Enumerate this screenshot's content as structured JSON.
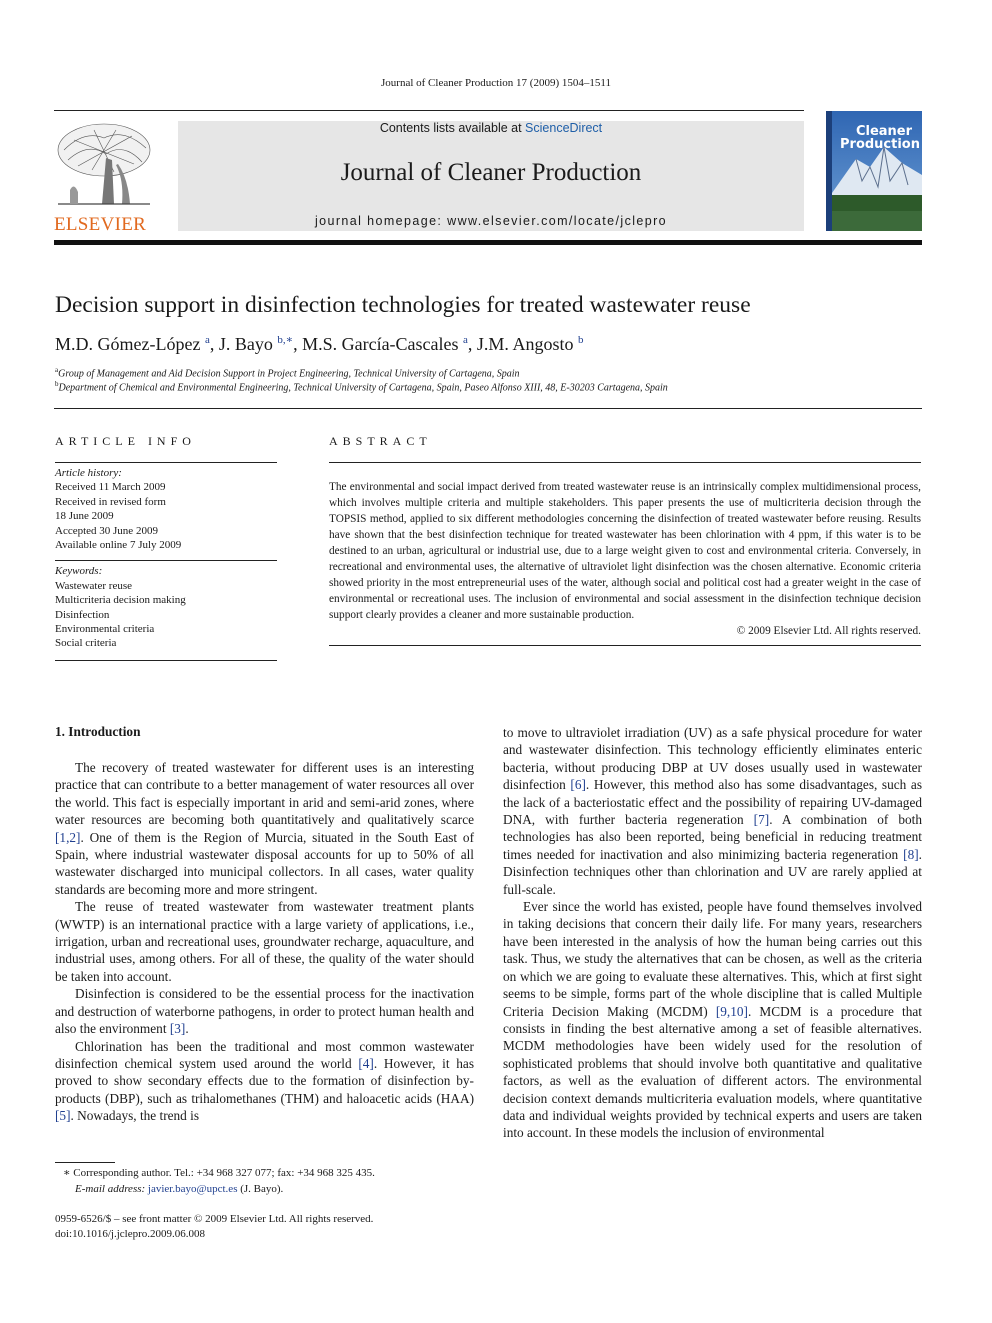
{
  "running_head": "Journal of Cleaner Production 17 (2009) 1504–1511",
  "masthead": {
    "publisher_logo": "ELSEVIER",
    "contents_prefix": "Contents lists available at ",
    "contents_link": "ScienceDirect",
    "journal_title": "Journal of Cleaner Production",
    "homepage": "journal homepage: www.elsevier.com/locate/jclepro",
    "cover_title_line1": "Cleaner",
    "cover_title_line2": "Production"
  },
  "colors": {
    "elsevier_orange": "#e1691f",
    "link_blue": "#1f5fa8",
    "ref_blue": "#1f3f8f",
    "banner_gray": "#e6e6e6"
  },
  "article": {
    "title": "Decision support in disinfection technologies for treated wastewater reuse",
    "authors": [
      {
        "name": "M.D. Gómez-López",
        "sup": "a",
        "sep": ", "
      },
      {
        "name": "J. Bayo",
        "sup": "b,∗",
        "sep": ", "
      },
      {
        "name": "M.S. García-Cascales",
        "sup": "a",
        "sep": ", "
      },
      {
        "name": "J.M. Angosto",
        "sup": "b",
        "sep": ""
      }
    ],
    "affiliations": [
      {
        "mark": "a",
        "text": "Group of Management and Aid Decision Support in Project Engineering, Technical University of Cartagena, Spain"
      },
      {
        "mark": "b",
        "text": "Department of Chemical and Environmental Engineering, Technical University of Cartagena, Spain, Paseo Alfonso XIII, 48, E-30203 Cartagena, Spain"
      }
    ]
  },
  "article_info": {
    "heading": "ARTICLE INFO",
    "history_label": "Article history:",
    "history": [
      "Received 11 March 2009",
      "Received in revised form",
      "18 June 2009",
      "Accepted 30 June 2009",
      "Available online 7 July 2009"
    ],
    "keywords_label": "Keywords:",
    "keywords": [
      "Wastewater reuse",
      "Multicriteria decision making",
      "Disinfection",
      "Environmental criteria",
      "Social criteria"
    ]
  },
  "abstract": {
    "heading": "ABSTRACT",
    "text": "The environmental and social impact derived from treated wastewater reuse is an intrinsically complex multidimensional process, which involves multiple criteria and multiple stakeholders. This paper presents the use of multicriteria decision through the TOPSIS method, applied to six different methodologies concerning the disinfection of treated wastewater before reusing. Results have shown that the best disinfection technique for treated wastewater has been chlorination with 4 ppm, if this water is to be destined to an urban, agricultural or industrial use, due to a large weight given to cost and environmental criteria. Conversely, in recreational and environmental uses, the alternative of ultraviolet light disinfection was the chosen alternative. Economic criteria showed priority in the most entrepreneurial uses of the water, although social and political cost had a greater weight in the case of environmental or recreational uses. The inclusion of environmental and social assessment in the disinfection technique decision support clearly provides a cleaner and more sustainable production.",
    "copyright": "© 2009 Elsevier Ltd. All rights reserved."
  },
  "body": {
    "section_heading": "1.  Introduction",
    "left_paragraphs": [
      [
        {
          "t": "The recovery of treated wastewater for different uses is an interesting practice that can contribute to a better management of water resources all over the world. This fact is especially important in arid and semi-arid zones, where water resources are becoming both quantitatively and qualitatively scarce "
        },
        {
          "r": "[1,2]"
        },
        {
          "t": ". One of them is the Region of Murcia, situated in the South East of Spain, where industrial wastewater disposal accounts for up to 50% of all wastewater discharged into municipal collectors. In all cases, water quality standards are becoming more and more stringent."
        }
      ],
      [
        {
          "t": "The reuse of treated wastewater from wastewater treatment plants (WWTP) is an international practice with a large variety of applications, i.e., irrigation, urban and recreational uses, groundwater recharge, aquaculture, and industrial uses, among others. For all of these, the quality of the water should be taken into account."
        }
      ],
      [
        {
          "t": "Disinfection is considered to be the essential process for the inactivation and destruction of waterborne pathogens, in order to protect human health and also the environment "
        },
        {
          "r": "[3]"
        },
        {
          "t": "."
        }
      ],
      [
        {
          "t": "Chlorination has been the traditional and most common wastewater disinfection chemical system used around the world "
        },
        {
          "r": "[4]"
        },
        {
          "t": ". However, it has proved to show secondary effects due to the formation of disinfection by-products (DBP), such as trihalomethanes (THM) and haloacetic acids (HAA) "
        },
        {
          "r": "[5]"
        },
        {
          "t": ". Nowadays, the trend is"
        }
      ]
    ],
    "right_paragraphs": [
      [
        {
          "t": "to move to ultraviolet irradiation (UV) as a safe physical procedure for water and wastewater disinfection. This technology efficiently eliminates enteric bacteria, without producing DBP at UV doses usually used in wastewater disinfection "
        },
        {
          "r": "[6]"
        },
        {
          "t": ". However, this method also has some disadvantages, such as the lack of a bacteriostatic effect and the possibility of repairing UV-damaged DNA, with further bacteria regeneration "
        },
        {
          "r": "[7]"
        },
        {
          "t": ". A combination of both technologies has also been reported, being beneficial in reducing treatment times needed for inactivation and also minimizing bacteria regeneration "
        },
        {
          "r": "[8]"
        },
        {
          "t": ". Disinfection techniques other than chlorination and UV are rarely applied at full-scale."
        }
      ],
      [
        {
          "t": "Ever since the world has existed, people have found themselves involved in taking decisions that concern their daily life. For many years, researchers have been interested in the analysis of how the human being carries out this task. Thus, we study the alternatives that can be chosen, as well as the criteria on which we are going to evaluate these alternatives. This, which at first sight seems to be simple, forms part of the whole discipline that is called Multiple Criteria Decision Making (MCDM) "
        },
        {
          "r": "[9,10]"
        },
        {
          "t": ". MCDM is a procedure that consists in finding the best alternative among a set of feasible alternatives. MCDM methodologies have been widely used for the resolution of sophisticated problems that should involve both quantitative and qualitative factors, as well as the evaluation of different actors. The environmental decision context demands multicriteria evaluation models, where quantitative data and individual weights provided by technical experts and users are taken into account. In these models the inclusion of environmental"
        }
      ]
    ]
  },
  "footnote": {
    "mark": "∗",
    "text": " Corresponding author. Tel.: +34 968 327 077; fax: +34 968 325 435.",
    "email_label": "E-mail address:",
    "email": "javier.bayo@upct.es",
    "email_suffix": " (J. Bayo)."
  },
  "bottom": {
    "issn_line": "0959-6526/$ – see front matter © 2009 Elsevier Ltd. All rights reserved.",
    "doi": "doi:10.1016/j.jclepro.2009.06.008"
  }
}
